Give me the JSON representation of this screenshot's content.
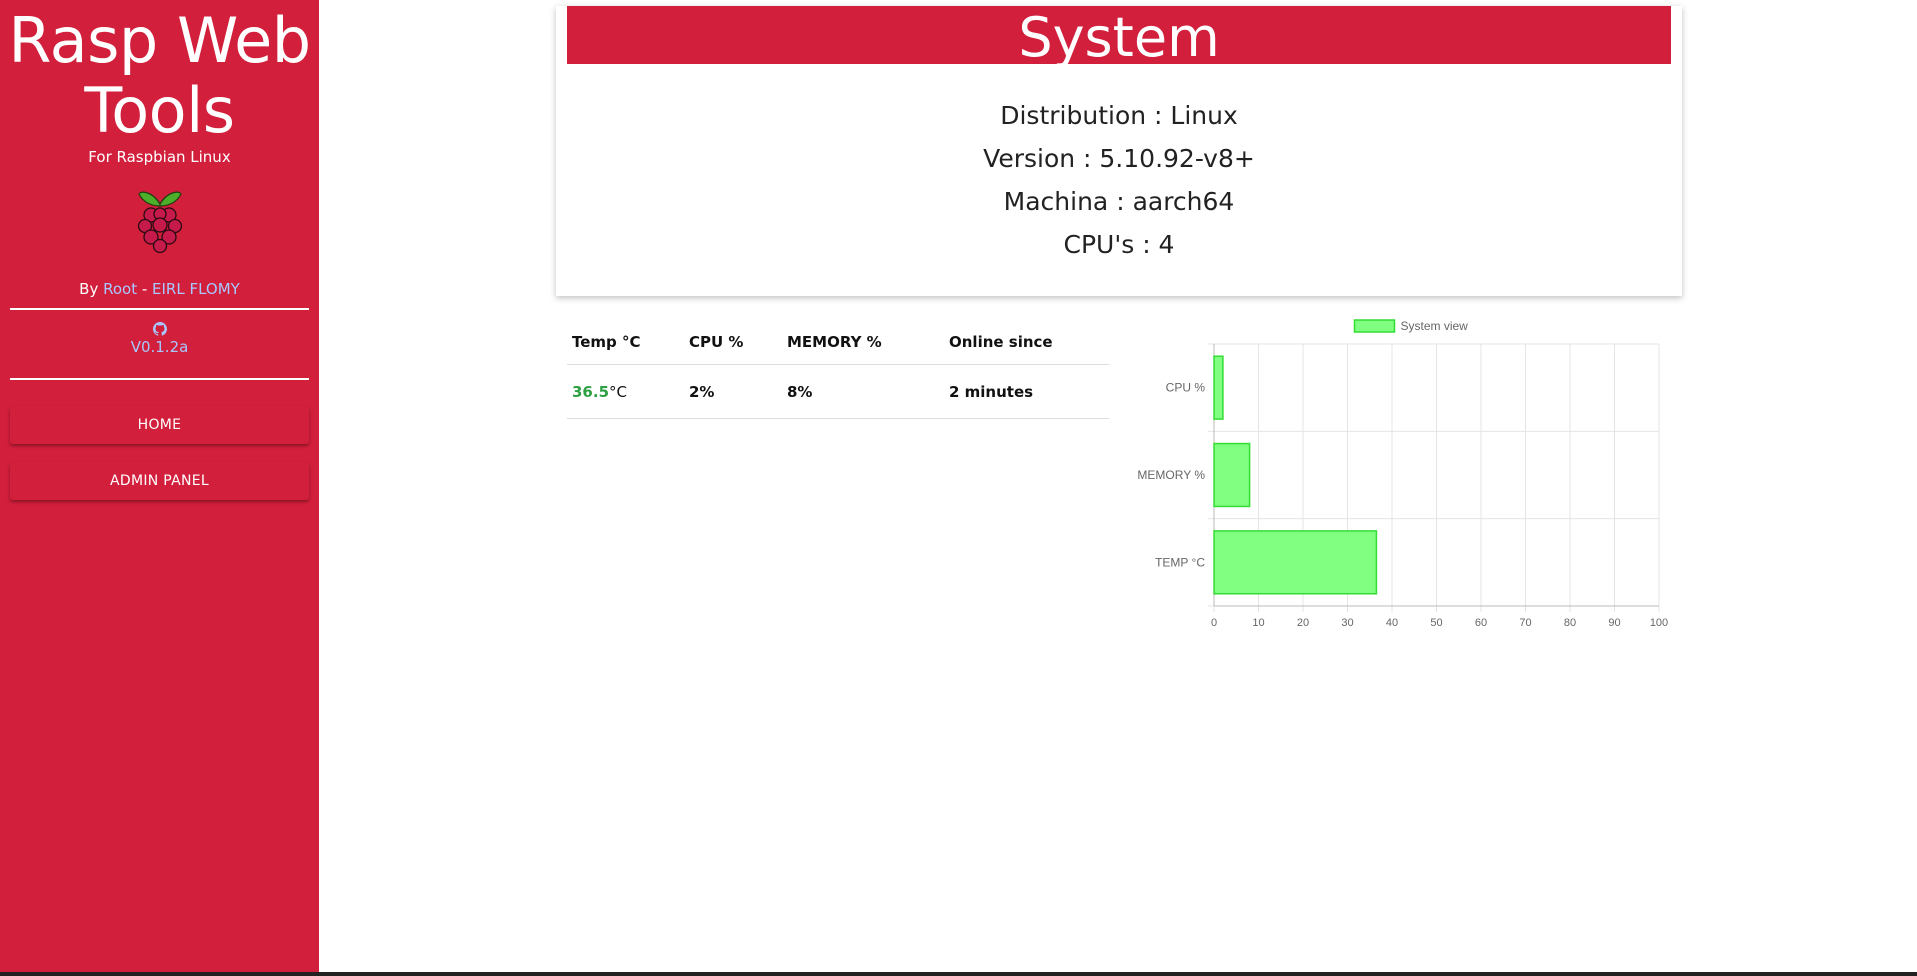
{
  "sidebar": {
    "title_line1": "Rasp Web",
    "title_line2": "Tools",
    "subtitle": "For Raspbian Linux",
    "by_prefix": "By ",
    "author_root": "Root",
    "separator": " - ",
    "author_company": "EIRL FLOMY",
    "version": "V0.1.2a",
    "nav": [
      {
        "label": "HOME"
      },
      {
        "label": "ADMIN PANEL"
      }
    ]
  },
  "system": {
    "title": "System",
    "distribution": "Distribution : Linux",
    "version": "Version : 5.10.92-v8+",
    "machina": "Machina : aarch64",
    "cpus": "CPU's : 4"
  },
  "stats": {
    "headers": [
      "Temp °C",
      "CPU %",
      "MEMORY %",
      "Online since"
    ],
    "temp_value": "36.5",
    "temp_unit": "°C",
    "cpu": "2%",
    "memory": "8%",
    "online": "2 minutes"
  },
  "colors": {
    "brand_red": "#d21f3c",
    "link_blue": "#a8c8ff",
    "good_green": "#2ea043",
    "bar_fill": "#80ff80",
    "bar_stroke": "#33dd33"
  },
  "chart_data": {
    "type": "bar",
    "orientation": "horizontal",
    "legend": "System view",
    "legend_position": "top",
    "categories": [
      "CPU %",
      "MEMORY %",
      "TEMP °C"
    ],
    "values": [
      2,
      8,
      36.5
    ],
    "xlim": [
      0,
      100
    ],
    "xticks": [
      0,
      10,
      20,
      30,
      40,
      50,
      60,
      70,
      80,
      90,
      100
    ],
    "grid": true
  }
}
